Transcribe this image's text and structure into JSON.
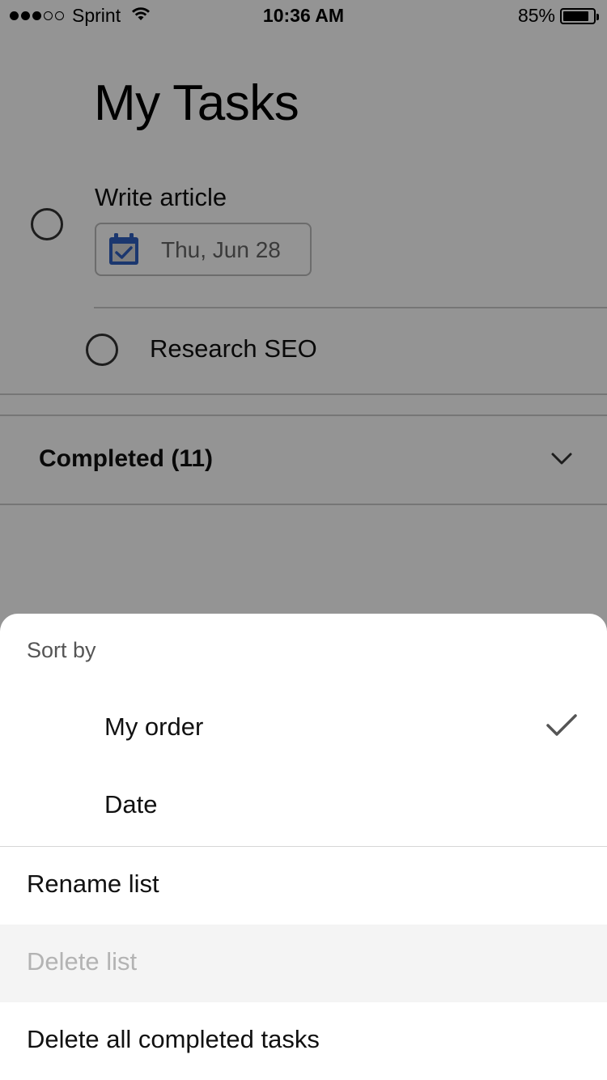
{
  "status_bar": {
    "carrier": "Sprint",
    "time": "10:36 AM",
    "battery_percent": "85%",
    "battery_level": 0.85,
    "signal_bars_filled": 3,
    "signal_bars_total": 5
  },
  "page": {
    "title": "My Tasks"
  },
  "tasks": [
    {
      "title": "Write article",
      "due_date": "Thu, Jun 28",
      "date_icon": "calendar-check-icon"
    },
    {
      "title": "Research SEO"
    }
  ],
  "completed_section": {
    "label": "Completed (11)",
    "icon": "chevron-down-icon"
  },
  "sheet": {
    "heading": "Sort by",
    "sort_options": [
      {
        "label": "My order",
        "selected": true
      },
      {
        "label": "Date",
        "selected": false
      }
    ],
    "actions": [
      {
        "label": "Rename list",
        "enabled": true
      },
      {
        "label": "Delete list",
        "enabled": false
      },
      {
        "label": "Delete all completed tasks",
        "enabled": true
      }
    ]
  },
  "colors": {
    "accent_blue": "#2f5fbf",
    "scrim": "rgba(0,0,0,0.42)",
    "disabled_row_bg": "#f4f4f4",
    "disabled_text": "#b3b3b3"
  }
}
